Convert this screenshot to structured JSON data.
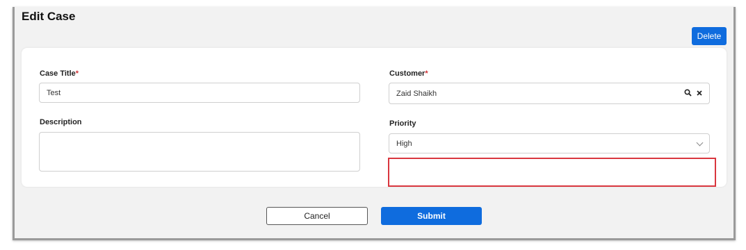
{
  "page": {
    "title": "Edit Case",
    "delete_label": "Delete"
  },
  "form": {
    "case_title": {
      "label": "Case Title",
      "required_mark": "*",
      "value": "Test"
    },
    "description": {
      "label": "Description",
      "value": ""
    },
    "customer": {
      "label": "Customer",
      "required_mark": "*",
      "value": "Zaid Shaikh",
      "search_icon": "search-icon",
      "clear_icon": "close-icon"
    },
    "priority": {
      "label": "Priority",
      "value": "High",
      "dropdown_icon": "chevron-down-icon"
    }
  },
  "actions": {
    "cancel_label": "Cancel",
    "submit_label": "Submit"
  },
  "colors": {
    "primary": "#0f6cde",
    "required": "#d13438",
    "highlight": "#d9363e"
  }
}
